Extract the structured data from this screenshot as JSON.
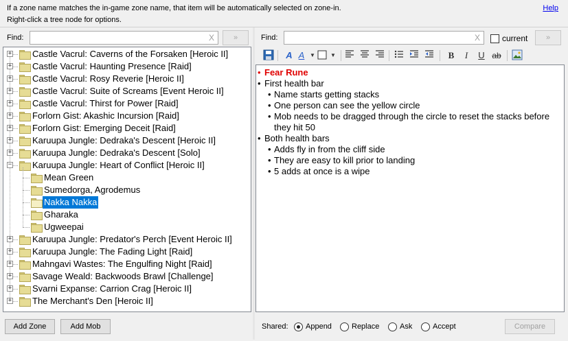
{
  "info": {
    "line1": "If a zone name matches the in-game zone name, that item will be automatically selected on zone-in.",
    "line2": "Right-click a tree node for options.",
    "help": "Help"
  },
  "left_find": {
    "label": "Find:",
    "value": "",
    "clear": "X",
    "go": "»"
  },
  "right_find": {
    "label": "Find:",
    "value": "",
    "clear": "X",
    "go": "»",
    "current_label": "current"
  },
  "tree": {
    "nodes": [
      {
        "label": "Castle Vacrul: Caverns of the Forsaken [Heroic II]",
        "expander": "+"
      },
      {
        "label": "Castle Vacrul: Haunting Presence [Raid]",
        "expander": "+"
      },
      {
        "label": "Castle Vacrul: Rosy Reverie [Heroic II]",
        "expander": "+"
      },
      {
        "label": "Castle Vacrul: Suite of Screams [Event Heroic II]",
        "expander": "+"
      },
      {
        "label": "Castle Vacrul: Thirst for Power [Raid]",
        "expander": "+"
      },
      {
        "label": "Forlorn Gist: Akashic Incursion [Raid]",
        "expander": "+"
      },
      {
        "label": "Forlorn Gist: Emerging Deceit [Raid]",
        "expander": "+"
      },
      {
        "label": "Karuupa Jungle: Dedraka's Descent [Heroic II]",
        "expander": "+"
      },
      {
        "label": "Karuupa Jungle: Dedraka's Descent [Solo]",
        "expander": "+"
      },
      {
        "label": "Karuupa Jungle: Heart of Conflict [Heroic II]",
        "expander": "−"
      }
    ],
    "children": [
      {
        "label": "Mean Green"
      },
      {
        "label": "Sumedorga, Agrodemus"
      },
      {
        "label": "Nakka Nakka"
      },
      {
        "label": "Gharaka"
      },
      {
        "label": "Ugweepai"
      }
    ],
    "nodes_after": [
      {
        "label": "Karuupa Jungle: Predator's Perch [Event Heroic II]",
        "expander": "+"
      },
      {
        "label": "Karuupa Jungle: The Fading Light [Raid]",
        "expander": "+"
      },
      {
        "label": "Mahngavi Wastes: The Engulfing Night [Raid]",
        "expander": "+"
      },
      {
        "label": "Savage Weald: Backwoods Brawl [Challenge]",
        "expander": "+"
      },
      {
        "label": "Svarni Expanse: Carrion Crag [Heroic II]",
        "expander": "+"
      },
      {
        "label": "The Merchant's Den [Heroic II]",
        "expander": "+"
      }
    ]
  },
  "editor": {
    "lines": [
      {
        "bullet": "•",
        "text": "Fear Rune"
      },
      {
        "bullet": "•",
        "text": "First health bar"
      },
      {
        "bullet": "•",
        "text": "Name starts getting stacks"
      },
      {
        "bullet": "•",
        "text": "One person can see the yellow circle"
      },
      {
        "bullet": "•",
        "text": "Mob needs to be dragged through the circle to reset the stacks before"
      },
      {
        "bullet": "",
        "text": "they hit 50"
      },
      {
        "bullet": "•",
        "text": "Both health bars"
      },
      {
        "bullet": "•",
        "text": "Adds fly in from the cliff side"
      },
      {
        "bullet": "•",
        "text": "They are easy to kill prior to landing"
      },
      {
        "bullet": "•",
        "text": "5 adds at once is a wipe"
      }
    ],
    "heading_color": "#e00000"
  },
  "toolbar": {
    "save": "save-icon",
    "font_a": "A",
    "font_color_a": "A",
    "bold": "B",
    "italic": "I",
    "underline": "U",
    "strike": "ab"
  },
  "bottom": {
    "add_zone": "Add Zone",
    "add_mob": "Add Mob",
    "shared_label": "Shared:",
    "append": "Append",
    "replace": "Replace",
    "ask": "Ask",
    "accept": "Accept",
    "compare": "Compare",
    "selected_option": "Append"
  }
}
